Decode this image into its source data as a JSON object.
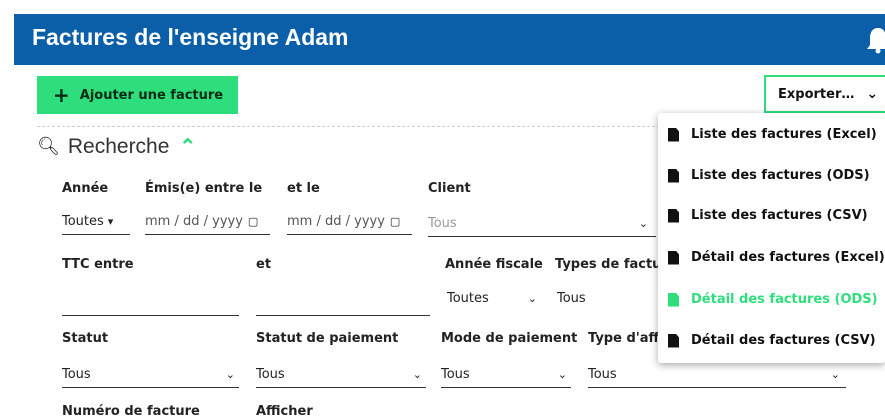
{
  "header": {
    "title": "Factures de l'enseigne Adam"
  },
  "toolbar": {
    "add_label": "Ajouter une facture",
    "export_label": "Exporter…"
  },
  "search": {
    "title": "Recherche"
  },
  "filters": {
    "annee": {
      "label": "Année",
      "value": "Toutes"
    },
    "emis_entre": {
      "label": "Émis(e) entre le",
      "placeholder": "mm / dd / yyyy"
    },
    "et_le": {
      "label": "et le",
      "placeholder": "mm / dd / yyyy"
    },
    "client": {
      "label": "Client",
      "value": "Tous"
    },
    "ttc_entre": {
      "label": "TTC entre"
    },
    "ttc_et": {
      "label": "et"
    },
    "annee_fiscale": {
      "label": "Année fiscale",
      "value": "Toutes"
    },
    "types_facture": {
      "label": "Types de factur",
      "value": "Tous"
    },
    "statut": {
      "label": "Statut",
      "value": "Tous"
    },
    "statut_paiement": {
      "label": "Statut de paiement",
      "value": "Tous"
    },
    "mode_paiement": {
      "label": "Mode de paiement",
      "value": "Tous"
    },
    "type_affaire": {
      "label": "Type d'affa",
      "value": "Tous"
    },
    "numero_facture": {
      "label": "Numéro de facture"
    },
    "afficher": {
      "label": "Afficher"
    }
  },
  "export_menu": {
    "items": [
      {
        "label": "Liste des factures (Excel)",
        "icon": "file-excel-icon"
      },
      {
        "label": "Liste des factures (ODS)",
        "icon": "file-ods-icon"
      },
      {
        "label": "Liste des factures (CSV)",
        "icon": "file-csv-icon"
      },
      {
        "label": "Détail des factures (Excel)",
        "icon": "file-excel-icon"
      },
      {
        "label": "Détail des factures (ODS)",
        "icon": "file-ods-icon",
        "highlighted": true
      },
      {
        "label": "Détail des factures (CSV)",
        "icon": "file-csv-icon"
      }
    ]
  },
  "colors": {
    "header": "#0b5fa8",
    "accent": "#2ede7c"
  }
}
